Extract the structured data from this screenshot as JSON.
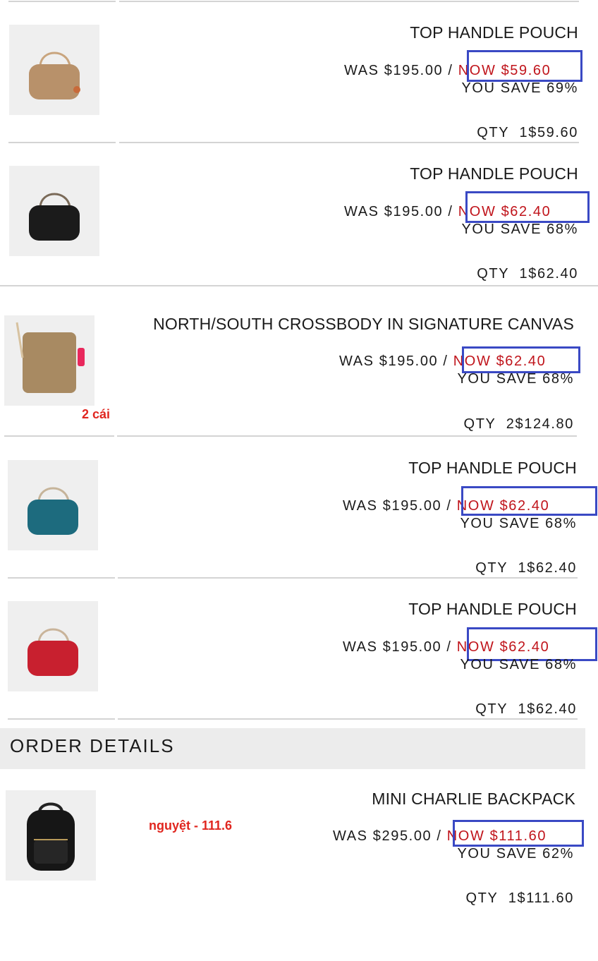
{
  "items": [
    {
      "name": "TOP HANDLE POUCH",
      "was": "WAS $195.00 / ",
      "now": "NOW $59.60",
      "save": "YOU SAVE 69%",
      "qty_label": "QTY",
      "qty_value": "1$59.60",
      "bag_color": "#b8916a"
    },
    {
      "name": "TOP HANDLE POUCH",
      "was": "WAS $195.00 / ",
      "now": "NOW $62.40",
      "save": "YOU SAVE 68%",
      "qty_label": "QTY",
      "qty_value": "1$62.40",
      "bag_color": "#1b1b1b"
    },
    {
      "name": "NORTH/SOUTH CROSSBODY IN SIGNATURE CANVAS",
      "was": "WAS $195.00 / ",
      "now": "NOW $62.40",
      "save": "YOU SAVE 68%",
      "qty_label": "QTY",
      "qty_value": "2$124.80",
      "bag_color": "#a88a62",
      "note": "2 cái"
    },
    {
      "name": "TOP HANDLE POUCH",
      "was": "WAS $195.00 / ",
      "now": "NOW $62.40",
      "save": "YOU SAVE 68%",
      "qty_label": "QTY",
      "qty_value": "1$62.40",
      "bag_color": "#1d6b7e"
    },
    {
      "name": "TOP HANDLE POUCH",
      "was": "WAS $195.00 / ",
      "now": "NOW $62.40",
      "save": "YOU SAVE 68%",
      "qty_label": "QTY",
      "qty_value": "1$62.40",
      "bag_color": "#c8202f"
    }
  ],
  "order_details": {
    "title": "ORDER DETAILS",
    "item": {
      "name": "MINI CHARLIE BACKPACK",
      "was": "WAS $295.00 / ",
      "now": "NOW $111.60",
      "save": "YOU SAVE 62%",
      "qty_label": "QTY",
      "qty_value": "1$111.60",
      "bag_color": "#161616",
      "note": "nguyệt - 111.6"
    }
  },
  "colors": {
    "highlight_box": "#3a49c4",
    "now_price": "#c0141b",
    "annotation": "#e0261f"
  }
}
